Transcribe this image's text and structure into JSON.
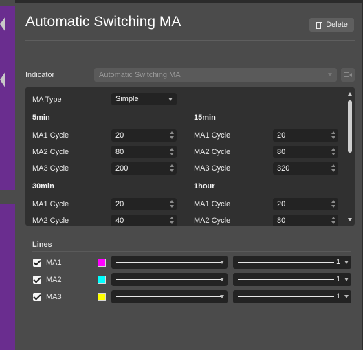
{
  "window": {
    "title": "Automatic Switching MA"
  },
  "header": {
    "delete_label": "Delete"
  },
  "indicator": {
    "label": "Indicator",
    "value": "Automatic Switching MA"
  },
  "ma_type": {
    "label": "MA Type",
    "value": "Simple"
  },
  "groups": [
    {
      "name": "5min",
      "fields": [
        {
          "label": "MA1 Cycle",
          "value": "20"
        },
        {
          "label": "MA2 Cycle",
          "value": "80"
        },
        {
          "label": "MA3 Cycle",
          "value": "200"
        }
      ]
    },
    {
      "name": "15min",
      "fields": [
        {
          "label": "MA1 Cycle",
          "value": "20"
        },
        {
          "label": "MA2 Cycle",
          "value": "80"
        },
        {
          "label": "MA3 Cycle",
          "value": "320"
        }
      ]
    },
    {
      "name": "30min",
      "fields": [
        {
          "label": "MA1 Cycle",
          "value": "20"
        },
        {
          "label": "MA2 Cycle",
          "value": "40"
        }
      ]
    },
    {
      "name": "1hour",
      "fields": [
        {
          "label": "MA1 Cycle",
          "value": "20"
        },
        {
          "label": "MA2 Cycle",
          "value": "80"
        }
      ]
    }
  ],
  "lines": {
    "title": "Lines",
    "items": [
      {
        "name": "MA1",
        "checked": true,
        "color": "#ff00ff",
        "width": "1"
      },
      {
        "name": "MA2",
        "checked": true,
        "color": "#00ffff",
        "width": "1"
      },
      {
        "name": "MA3",
        "checked": true,
        "color": "#ffff00",
        "width": "1"
      }
    ]
  },
  "icons": {
    "delete": "trash-icon",
    "indicator_caret": "chevron-down-icon",
    "video": "video-camera-icon"
  }
}
